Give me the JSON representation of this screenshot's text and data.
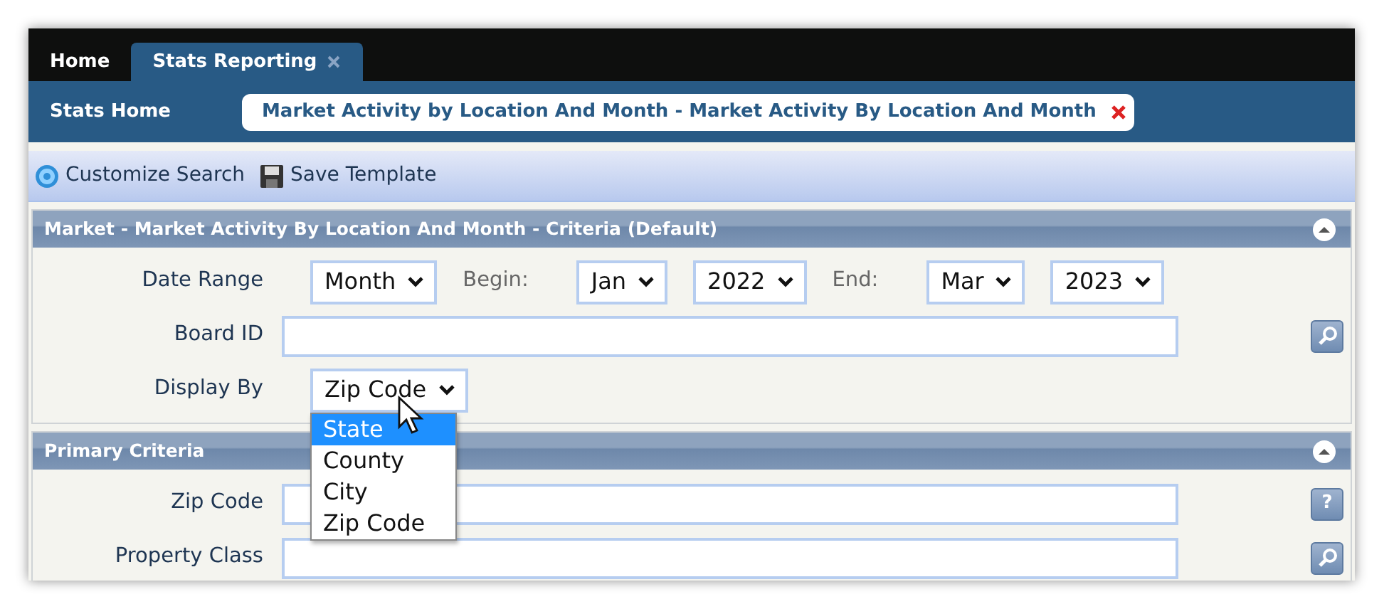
{
  "tabs": [
    {
      "label": "Home",
      "selected": false,
      "closable": false
    },
    {
      "label": "Stats Reporting",
      "selected": true,
      "closable": true
    }
  ],
  "breadcrumb": {
    "home": "Stats Home",
    "report": "Market Activity by Location And Month - Market Activity By Location And Month",
    "closable": true
  },
  "toolbar": [
    {
      "kind": "gear",
      "label": "Customize Search"
    },
    {
      "kind": "save",
      "label": "Save Template"
    }
  ],
  "sections": [
    {
      "title": "Market - Market Activity By Location And Month - Criteria (Default)",
      "expanded": true,
      "rows": [
        {
          "label": "Date Range",
          "kind": "inline",
          "items": [
            {
              "kind": "select",
              "value": "Month"
            },
            {
              "kind": "label",
              "text": "Begin:"
            },
            {
              "kind": "select",
              "value": "Jan"
            },
            {
              "kind": "select",
              "value": "2022"
            },
            {
              "kind": "label",
              "text": "End:"
            },
            {
              "kind": "select",
              "value": "Mar"
            },
            {
              "kind": "select",
              "value": "2023"
            }
          ]
        },
        {
          "label": "Board ID",
          "kind": "text",
          "button": {
            "kind": "lookup"
          }
        },
        {
          "label": "Display By",
          "kind": "select",
          "value": "Zip Code",
          "open": true,
          "options": [
            {
              "label": "State",
              "highlighted": true
            },
            {
              "label": "County",
              "highlighted": false
            },
            {
              "label": "City",
              "highlighted": false
            },
            {
              "label": "Zip Code",
              "highlighted": false
            }
          ]
        }
      ]
    },
    {
      "title": "Primary Criteria",
      "expanded": true,
      "rows": [
        {
          "label": "Zip Code",
          "kind": "text",
          "button": {
            "kind": "help",
            "text": "?"
          }
        },
        {
          "label": "Property Class",
          "kind": "text",
          "button": {
            "kind": "lookup"
          }
        }
      ]
    }
  ]
}
